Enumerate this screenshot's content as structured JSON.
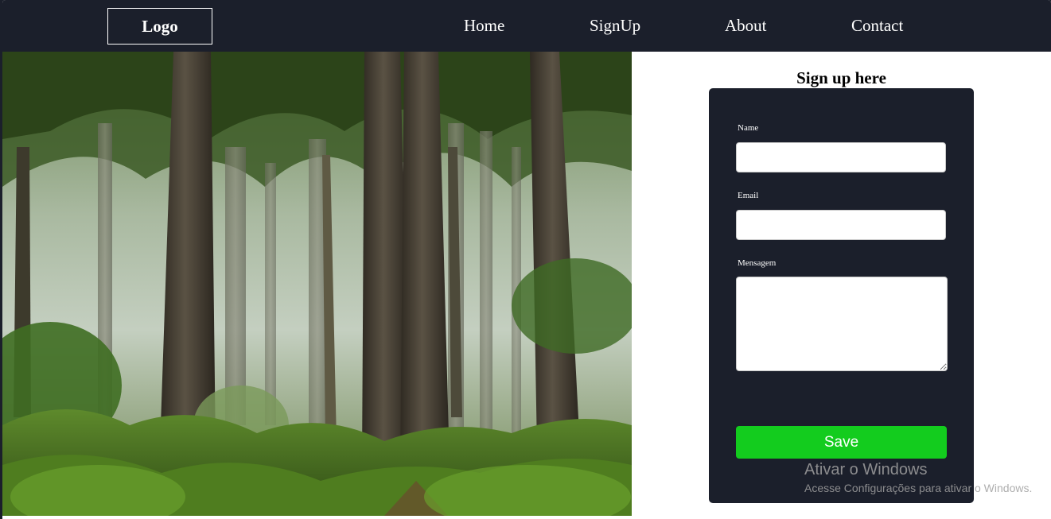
{
  "nav": {
    "logo": "Logo",
    "links": [
      "Home",
      "SignUp",
      "About",
      "Contact"
    ]
  },
  "hero": {
    "image": "forest-photo"
  },
  "form": {
    "title": "Sign up here",
    "name_label": "Name",
    "name_value": "",
    "email_label": "Email",
    "email_value": "",
    "message_label": "Mensagem",
    "message_value": "",
    "save_label": "Save"
  },
  "watermark": {
    "title": "Ativar o Windows",
    "subtitle": "Acesse Configurações para ativar o Windows."
  },
  "colors": {
    "nav_bg": "#1b1f2b",
    "card_bg": "#1b1f2b",
    "save_button": "#13cc1e",
    "page_bg": "#ffffff"
  }
}
